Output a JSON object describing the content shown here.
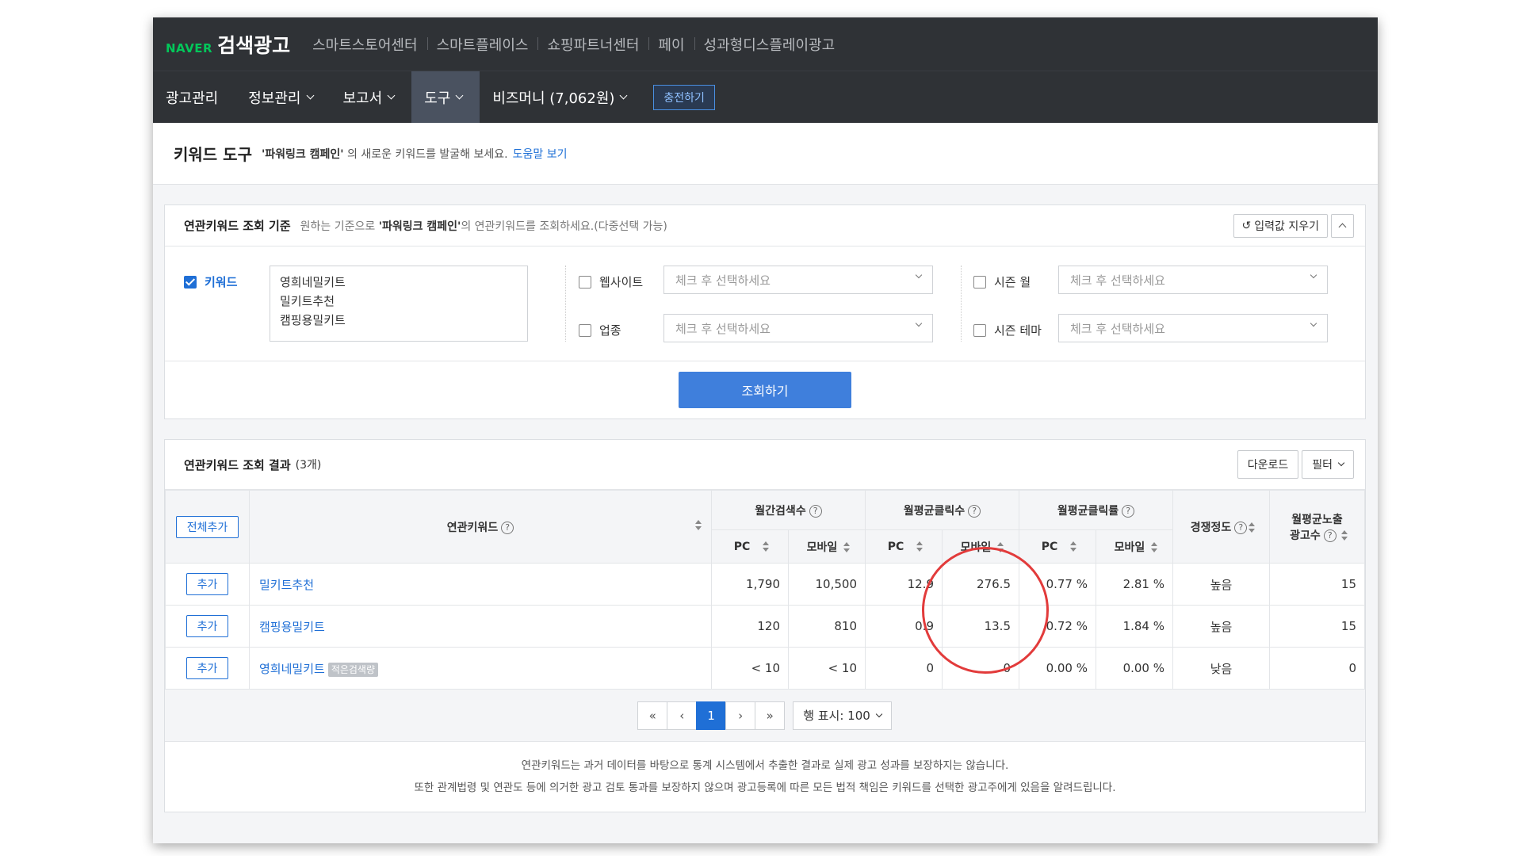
{
  "brand": {
    "naver": "NAVER",
    "title": "검색광고"
  },
  "sites": [
    "스마트스토어센터",
    "스마트플레이스",
    "쇼핑파트너센터",
    "페이",
    "성과형디스플레이광고"
  ],
  "nav": {
    "items": [
      {
        "label": "광고관리"
      },
      {
        "label": "정보관리"
      },
      {
        "label": "보고서"
      },
      {
        "label": "도구"
      },
      {
        "label": "비즈머니 (7,062원)"
      }
    ],
    "charge": "충전하기"
  },
  "header": {
    "title": "키워드 도구",
    "desc_quote": "'파워링크 캠페인'",
    "desc_rest": " 의 새로운 키워드를 발굴해 보세요.",
    "help": "도움말 보기"
  },
  "criteria": {
    "title": "연관키워드 조회 기준",
    "desc_pre": "원하는 기준으로 ",
    "desc_quote": "'파워링크 캠페인'",
    "desc_post": "의 연관키워드를 조회하세요.(다중선택 가능)",
    "clear": "입력값 지우기",
    "keyword_label": "키워드",
    "keywords": [
      "영희네밀키트",
      "밀키트추천",
      "캠핑용밀키트"
    ],
    "website_label": "웹사이트",
    "industry_label": "업종",
    "season_month_label": "시즌 월",
    "season_theme_label": "시즌 테마",
    "select_placeholder": "체크 후 선택하세요",
    "search": "조회하기"
  },
  "results": {
    "title": "연관키워드 조회 결과",
    "count": "(3개)",
    "download": "다운로드",
    "filter": "필터",
    "add_all": "전체추가",
    "headers": {
      "keyword": "연관키워드",
      "monthly_search": "월간검색수",
      "monthly_clicks": "월평균클릭수",
      "monthly_ctr": "월평균클릭률",
      "competition": "경쟁정도",
      "ads_line1": "월평균노출",
      "ads_line2": "광고수",
      "pc": "PC",
      "mobile": "모바일"
    },
    "add_label": "추가",
    "rows": [
      {
        "keyword": "밀키트추천",
        "badge": "",
        "pc_search": "1,790",
        "mobile_search": "10,500",
        "pc_clicks": "12.9",
        "mobile_clicks": "276.5",
        "pc_ctr": "0.77 %",
        "mobile_ctr": "2.81 %",
        "competition": "높음",
        "ads": "15"
      },
      {
        "keyword": "캠핑용밀키트",
        "badge": "",
        "pc_search": "120",
        "mobile_search": "810",
        "pc_clicks": "0.9",
        "mobile_clicks": "13.5",
        "pc_ctr": "0.72 %",
        "mobile_ctr": "1.84 %",
        "competition": "높음",
        "ads": "15"
      },
      {
        "keyword": "영희네밀키트",
        "badge": "적은검색량",
        "pc_search": "< 10",
        "mobile_search": "< 10",
        "pc_clicks": "0",
        "mobile_clicks": "0",
        "pc_ctr": "0.00 %",
        "mobile_ctr": "0.00 %",
        "competition": "낮음",
        "ads": "0"
      }
    ],
    "pager": {
      "first": "«",
      "prev": "‹",
      "current": "1",
      "next": "›",
      "last": "»",
      "rows_label": "행 표시: 100"
    },
    "notice": [
      "연관키워드는 과거 데이터를 바탕으로 통계 시스템에서 추출한 결과로 실제 광고 성과를 보장하지는 않습니다.",
      "또한 관계법령 및 연관도 등에 의거한 광고 검토 통과를 보장하지 않으며 광고등록에 따른 모든 법적 책임은 키워드를 선택한 광고주에게 있음을 알려드립니다."
    ]
  },
  "colors": {
    "accent": "#1f6fd6",
    "brand_green": "#03c75a",
    "topbar": "#2f3236",
    "annotation": "#e23b3b"
  }
}
